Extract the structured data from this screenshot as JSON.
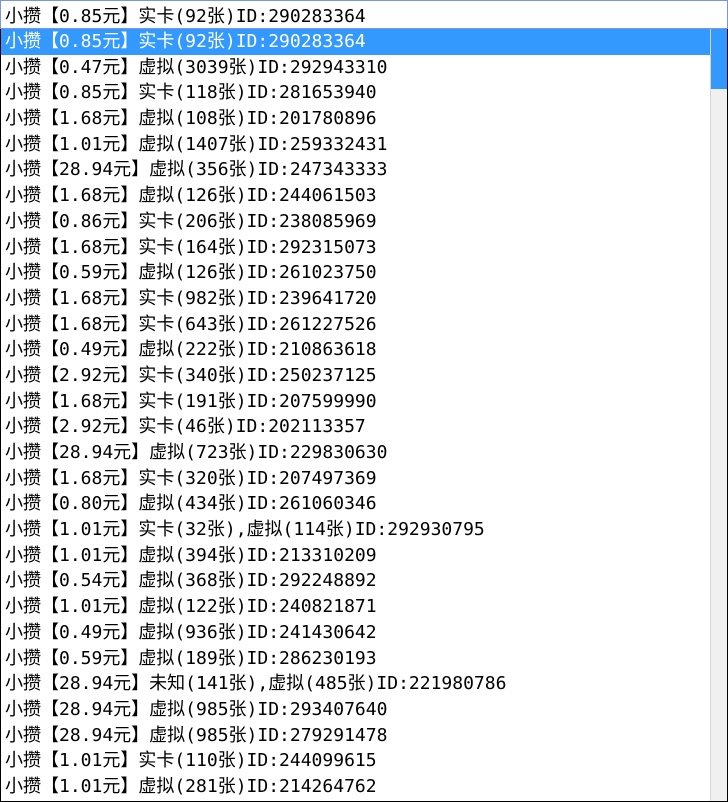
{
  "combo": {
    "selected_text": "小攒【0.85元】实卡(92张)ID:290283364",
    "selected_index": 0,
    "items": [
      "小攒【0.85元】实卡(92张)ID:290283364",
      "小攒【0.47元】虚拟(3039张)ID:292943310",
      "小攒【0.85元】实卡(118张)ID:281653940",
      "小攒【1.68元】虚拟(108张)ID:201780896",
      "小攒【1.01元】虚拟(1407张)ID:259332431",
      "小攒【28.94元】虚拟(356张)ID:247343333",
      "小攒【1.68元】虚拟(126张)ID:244061503",
      "小攒【0.86元】实卡(206张)ID:238085969",
      "小攒【1.68元】实卡(164张)ID:292315073",
      "小攒【0.59元】虚拟(126张)ID:261023750",
      "小攒【1.68元】实卡(982张)ID:239641720",
      "小攒【1.68元】实卡(643张)ID:261227526",
      "小攒【0.49元】虚拟(222张)ID:210863618",
      "小攒【2.92元】实卡(340张)ID:250237125",
      "小攒【1.68元】实卡(191张)ID:207599990",
      "小攒【2.92元】实卡(46张)ID:202113357",
      "小攒【28.94元】虚拟(723张)ID:229830630",
      "小攒【1.68元】实卡(320张)ID:207497369",
      "小攒【0.80元】虚拟(434张)ID:261060346",
      "小攒【1.01元】实卡(32张),虚拟(114张)ID:292930795",
      "小攒【1.01元】虚拟(394张)ID:213310209",
      "小攒【0.54元】虚拟(368张)ID:292248892",
      "小攒【1.01元】虚拟(122张)ID:240821871",
      "小攒【0.49元】虚拟(936张)ID:241430642",
      "小攒【0.59元】虚拟(189张)ID:286230193",
      "小攒【28.94元】未知(141张),虚拟(485张)ID:221980786",
      "小攒【28.94元】虚拟(985张)ID:293407640",
      "小攒【28.94元】虚拟(985张)ID:279291478",
      "小攒【1.01元】实卡(110张)ID:244099615",
      "小攒【1.01元】虚拟(281张)ID:214264762"
    ]
  }
}
